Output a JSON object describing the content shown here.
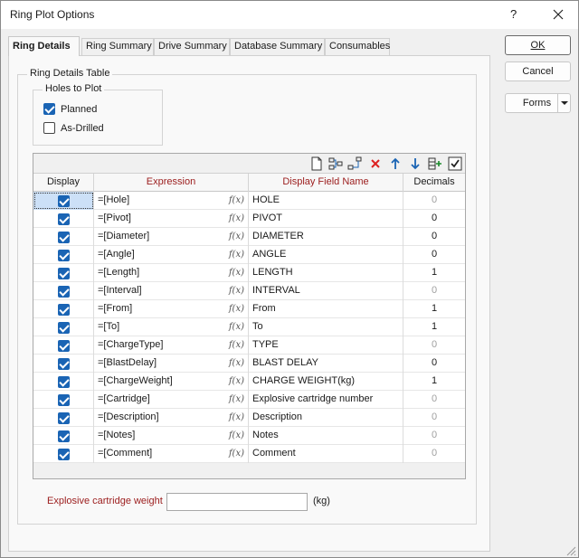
{
  "window": {
    "title": "Ring Plot Options",
    "help_label": "?"
  },
  "tabs": [
    {
      "label": "Ring Details"
    },
    {
      "label": "Ring Summary"
    },
    {
      "label": "Drive Summary"
    },
    {
      "label": "Database Summary"
    },
    {
      "label": "Consumables"
    }
  ],
  "ring_details": {
    "group_label": "Ring Details Table",
    "holes_group_label": "Holes to Plot",
    "planned_label": "Planned",
    "planned_checked": true,
    "as_drilled_label": "As-Drilled",
    "as_drilled_checked": false
  },
  "grid": {
    "headers": {
      "display": "Display",
      "expression": "Expression",
      "field_name": "Display Field Name",
      "decimals": "Decimals"
    },
    "fx_glyph": "f(x)",
    "rows": [
      {
        "expression": "=[Hole]",
        "field_name": "HOLE",
        "decimals": "0",
        "decimals_disabled": true
      },
      {
        "expression": "=[Pivot]",
        "field_name": "PIVOT",
        "decimals": "0",
        "decimals_disabled": false
      },
      {
        "expression": "=[Diameter]",
        "field_name": "DIAMETER",
        "decimals": "0",
        "decimals_disabled": false
      },
      {
        "expression": "=[Angle]",
        "field_name": "ANGLE",
        "decimals": "0",
        "decimals_disabled": false
      },
      {
        "expression": "=[Length]",
        "field_name": "LENGTH",
        "decimals": "1",
        "decimals_disabled": false
      },
      {
        "expression": "=[Interval]",
        "field_name": "INTERVAL",
        "decimals": "0",
        "decimals_disabled": true
      },
      {
        "expression": "=[From]",
        "field_name": "From",
        "decimals": "1",
        "decimals_disabled": false
      },
      {
        "expression": "=[To]",
        "field_name": "To",
        "decimals": "1",
        "decimals_disabled": false
      },
      {
        "expression": "=[ChargeType]",
        "field_name": "TYPE",
        "decimals": "0",
        "decimals_disabled": true
      },
      {
        "expression": "=[BlastDelay]",
        "field_name": "BLAST DELAY",
        "decimals": "0",
        "decimals_disabled": false
      },
      {
        "expression": "=[ChargeWeight]",
        "field_name": "CHARGE WEIGHT(kg)",
        "decimals": "1",
        "decimals_disabled": false
      },
      {
        "expression": "=[Cartridge]",
        "field_name": "Explosive cartridge number",
        "decimals": "0",
        "decimals_disabled": true
      },
      {
        "expression": "=[Description]",
        "field_name": "Description",
        "decimals": "0",
        "decimals_disabled": true
      },
      {
        "expression": "=[Notes]",
        "field_name": "Notes",
        "decimals": "0",
        "decimals_disabled": true
      },
      {
        "expression": "=[Comment]",
        "field_name": "Comment",
        "decimals": "0",
        "decimals_disabled": true
      }
    ]
  },
  "cartridge_weight": {
    "label": "Explosive cartridge weight",
    "value": "",
    "unit": "(kg)"
  },
  "buttons": {
    "ok": "OK",
    "cancel": "Cancel",
    "forms": "Forms"
  },
  "colors": {
    "accent": "#1a64b4",
    "required_label": "#9b1c1c",
    "disabled_text": "#a0a0a0"
  }
}
